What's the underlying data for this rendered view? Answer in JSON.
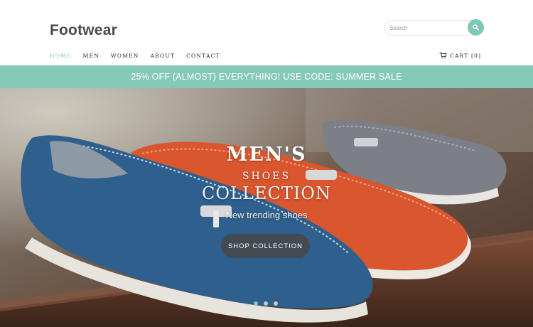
{
  "brand": {
    "logo": "Footwear"
  },
  "search": {
    "placeholder": "Search",
    "icon": "search-icon"
  },
  "nav": {
    "items": [
      {
        "label": "HOME",
        "active": true
      },
      {
        "label": "MEN",
        "active": false
      },
      {
        "label": "WOMEN",
        "active": false
      },
      {
        "label": "ABOUT",
        "active": false
      },
      {
        "label": "CONTACT",
        "active": false
      }
    ],
    "cart_label": "CART [0]",
    "cart_icon": "cart-icon"
  },
  "promo": {
    "text": "25% OFF (ALMOST) EVERYTHING! USE CODE: SUMMER SALE"
  },
  "hero": {
    "title_line1": "MEN'S",
    "title_line2": "SHOES",
    "title_line3": "COLLECTION",
    "subtitle": "New trending shoes",
    "button_label": "SHOP COLLECTION",
    "slides_count": 3,
    "active_slide": 1
  },
  "colors": {
    "accent": "#85c9b9",
    "text_dark": "#4a4a4a",
    "promo_text": "#ffffff",
    "shoe_blue": "#2f5f8c",
    "shoe_orange": "#d9562f",
    "shoe_grey": "#7c7f88"
  }
}
